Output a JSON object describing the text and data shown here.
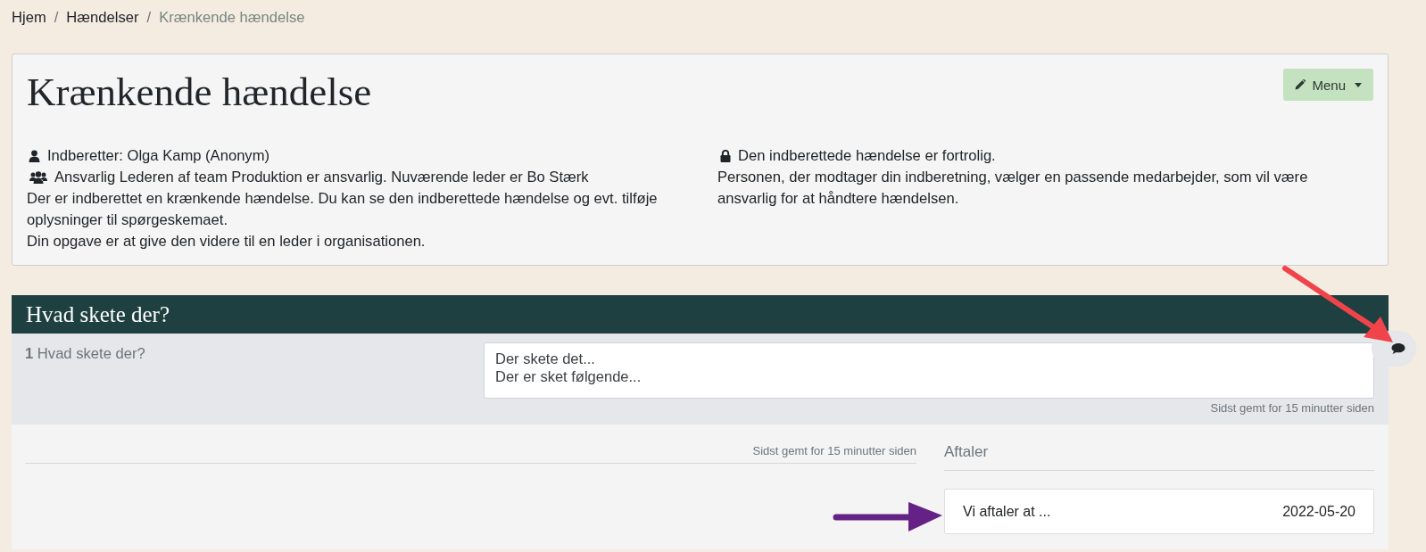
{
  "breadcrumb": [
    {
      "label": "Hjem",
      "active": false,
      "separator": "/"
    },
    {
      "label": "Hændelser",
      "active": false,
      "separator": "/"
    },
    {
      "label": "Krænkende hændelse",
      "active": true
    }
  ],
  "header": {
    "title": "Krænkende hændelse",
    "menu_button": "Menu",
    "reporter": "Indberetter: Olga Kamp (Anonym)",
    "responsible": "Ansvarlig Lederen af team Produktion er ansvarlig. Nuværende leder er Bo Stærk",
    "left_paragraphs": [
      "Der er indberettet en krænkende hændelse. Du kan se den indberettede hændelse og evt. tilføje oplysninger til spørgeskemaet.",
      "Din opgave er at give den videre til en leder i organisationen."
    ],
    "confidential": "Den indberettede hændelse er fortrolig.",
    "right_paragraphs": [
      "Personen, der modtager din indberetning, vælger en passende medarbejder, som vil være ansvarlig for at håndtere hændelsen."
    ]
  },
  "section": {
    "title": "Hvad skete der?",
    "questions": [
      {
        "number": "1",
        "label": "Hvad skete der?",
        "value": "Der skete det...\nDer er sket følgende...",
        "saved": "Sidst gemt for 15 minutter siden"
      }
    ],
    "notes_saved": "Sidst gemt for 15 minutter siden",
    "agreements": {
      "title": "Aftaler",
      "items": [
        {
          "text": "Vi aftaler at ...",
          "date": "2022-05-20"
        }
      ]
    }
  }
}
